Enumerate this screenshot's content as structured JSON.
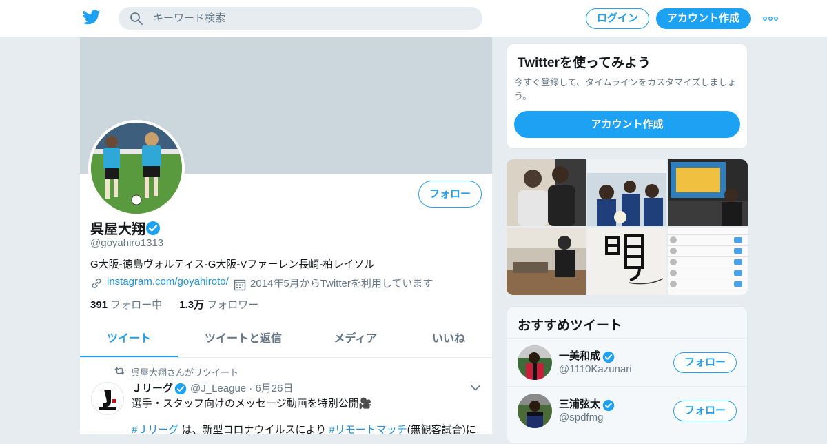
{
  "header": {
    "search_placeholder": "キーワード検索",
    "login_label": "ログイン",
    "signup_label": "アカウント作成"
  },
  "profile": {
    "follow_label": "フォロー",
    "name": "呉屋大翔",
    "handle": "@goyahiro1313",
    "bio": "G大阪-徳島ヴォルティス-G大阪-Vファーレン長崎-柏レイソル",
    "link": "instagram.com/goyahiroto/",
    "joined": "2014年5月からTwitterを利用しています",
    "following_count": "391",
    "following_label": "フォロー中",
    "followers_count": "1.3万",
    "followers_label": "フォロワー"
  },
  "tabs": [
    {
      "label": "ツイート",
      "active": true
    },
    {
      "label": "ツイートと返信",
      "active": false
    },
    {
      "label": "メディア",
      "active": false
    },
    {
      "label": "いいね",
      "active": false
    }
  ],
  "tweet": {
    "retweet_text": "呉屋大翔さんがリツイート",
    "author_name": "Ｊリーグ",
    "author_handle": "@J_League",
    "date": "6月26日",
    "text_line1": "選手・スタッフ向けのメッセージ動画を特別公開🎥",
    "hashtag1": "#Ｊリーグ",
    "text_mid": " は、新型コロナウイルスにより ",
    "hashtag2": "#リモートマッチ",
    "text_end": "(無観客試合)に"
  },
  "signup_card": {
    "title": "Twitterを使ってみよう",
    "description": "今すぐ登録して、タイムラインをカスタマイズしましょう。",
    "button_label": "アカウント作成"
  },
  "recommended": {
    "title": "おすすめツイート",
    "items": [
      {
        "name": "一美和成",
        "handle": "@1110Kazunari",
        "follow_label": "フォロー"
      },
      {
        "name": "三浦弦太",
        "handle": "@spdfmg",
        "follow_label": "フォロー"
      }
    ]
  },
  "colors": {
    "accent": "#1da1f2",
    "background": "#e6ecf0",
    "banner": "#ccd6dd"
  }
}
